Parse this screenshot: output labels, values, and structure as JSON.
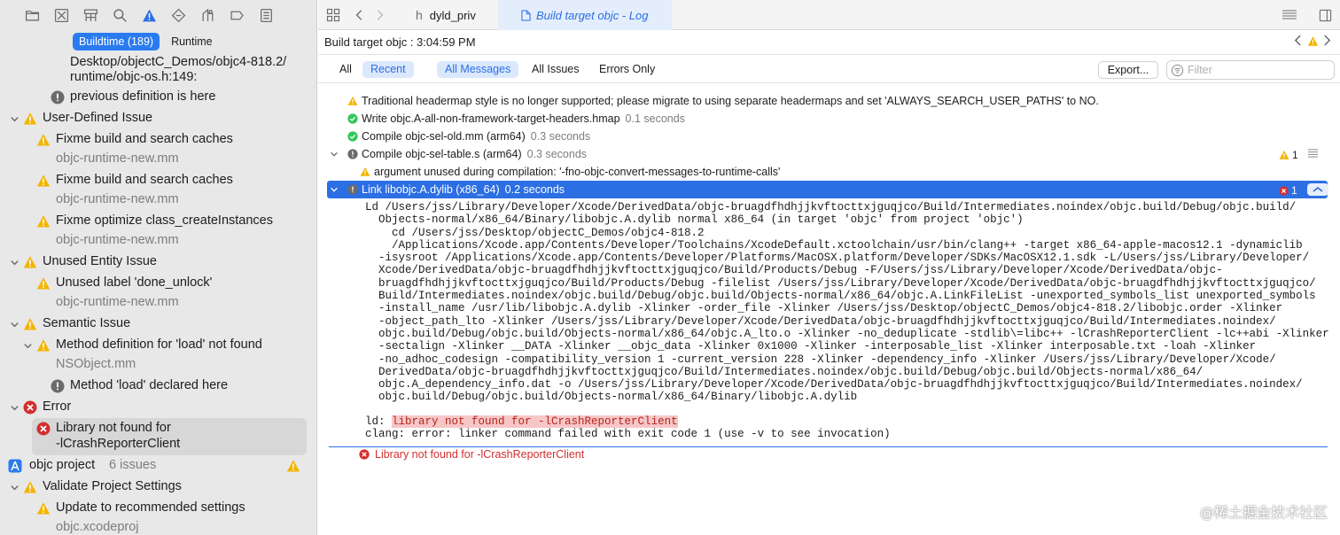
{
  "navigator": {
    "scope_buildtime": "Buildtime (189)",
    "scope_runtime": "Runtime",
    "items": [
      {
        "text": "Desktop/objectC_Demos/objc4-818.2/",
        "kind": "path"
      },
      {
        "text": "runtime/objc-os.h:149:",
        "kind": "path"
      },
      {
        "text": "previous definition is here",
        "kind": "note"
      },
      {
        "text": "User-Defined Issue",
        "kind": "group"
      },
      {
        "text": "Fixme build and search caches",
        "kind": "warning"
      },
      {
        "text": "objc-runtime-new.mm",
        "kind": "file"
      },
      {
        "text": "Fixme build and search caches",
        "kind": "warning"
      },
      {
        "text": "objc-runtime-new.mm",
        "kind": "file"
      },
      {
        "text": "Fixme optimize class_createInstances",
        "kind": "warning"
      },
      {
        "text": "objc-runtime-new.mm",
        "kind": "file"
      },
      {
        "text": "Unused Entity Issue",
        "kind": "group"
      },
      {
        "text": "Unused label 'done_unlock'",
        "kind": "warning"
      },
      {
        "text": "objc-runtime-new.mm",
        "kind": "file"
      },
      {
        "text": "Semantic Issue",
        "kind": "group"
      },
      {
        "text": "Method definition for 'load' not found",
        "kind": "warning"
      },
      {
        "text": "NSObject.mm",
        "kind": "file"
      },
      {
        "text": "Method 'load' declared here",
        "kind": "note"
      },
      {
        "text": "Error",
        "kind": "errorgroup"
      },
      {
        "text": "Library not found for",
        "kind": "error"
      },
      {
        "text": "-lCrashReporterClient",
        "kind": "errorcont"
      },
      {
        "text": "objc project",
        "kind": "project",
        "count": "6 issues"
      },
      {
        "text": "Validate Project Settings",
        "kind": "group"
      },
      {
        "text": "Update to recommended settings",
        "kind": "warning"
      },
      {
        "text": "objc.xcodeproj",
        "kind": "file"
      }
    ]
  },
  "editor": {
    "tab1": "dyld_priv",
    "tab2": "Build target objc - Log",
    "jump_title": "Build target objc : 3:04:59 PM",
    "filters": {
      "all": "All",
      "recent": "Recent",
      "all_messages": "All Messages",
      "all_issues": "All Issues",
      "errors_only": "Errors Only",
      "export": "Export...",
      "filter_placeholder": "Filter"
    },
    "log": [
      {
        "icon": "warning",
        "text": "Traditional headermap style is no longer supported; please migrate to using separate headermaps and set 'ALWAYS_SEARCH_USER_PATHS' to NO.",
        "time": ""
      },
      {
        "icon": "success",
        "text": "Write objc.A-all-non-framework-target-headers.hmap",
        "time": "0.1 seconds"
      },
      {
        "icon": "success",
        "text": "Compile objc-sel-old.mm (arm64)",
        "time": "0.3 seconds"
      },
      {
        "icon": "note",
        "text": "Compile objc-sel-table.s (arm64)",
        "time": "0.3 seconds",
        "badge": "1"
      },
      {
        "icon": "warning",
        "text": "argument unused during compilation: '-fno-objc-convert-messages-to-runtime-calls'",
        "time": ""
      },
      {
        "icon": "note",
        "text": "Link libobjc.A.dylib (x86_64)",
        "time": "0.2 seconds",
        "badge": "1"
      }
    ],
    "command_lines": [
      "Ld /Users/jss/Library/Developer/Xcode/DerivedData/objc-bruagdfhdhjjkvftocttxjguqjco/Build/Intermediates.noindex/objc.build/Debug/objc.build/",
      "  Objects-normal/x86_64/Binary/libobjc.A.dylib normal x86_64 (in target 'objc' from project 'objc')",
      "    cd /Users/jss/Desktop/objectC_Demos/objc4-818.2",
      "    /Applications/Xcode.app/Contents/Developer/Toolchains/XcodeDefault.xctoolchain/usr/bin/clang++ -target x86_64-apple-macos12.1 -dynamiclib",
      "  -isysroot /Applications/Xcode.app/Contents/Developer/Platforms/MacOSX.platform/Developer/SDKs/MacOSX12.1.sdk -L/Users/jss/Library/Developer/",
      "  Xcode/DerivedData/objc-bruagdfhdhjjkvftocttxjguqjco/Build/Products/Debug -F/Users/jss/Library/Developer/Xcode/DerivedData/objc-",
      "  bruagdfhdhjjkvftocttxjguqjco/Build/Products/Debug -filelist /Users/jss/Library/Developer/Xcode/DerivedData/objc-bruagdfhdhjjkvftocttxjguqjco/",
      "  Build/Intermediates.noindex/objc.build/Debug/objc.build/Objects-normal/x86_64/objc.A.LinkFileList -unexported_symbols_list unexported_symbols",
      "  -install_name /usr/lib/libobjc.A.dylib -Xlinker -order_file -Xlinker /Users/jss/Desktop/objectC_Demos/objc4-818.2/libobjc.order -Xlinker",
      "  -object_path_lto -Xlinker /Users/jss/Library/Developer/Xcode/DerivedData/objc-bruagdfhdhjjkvftocttxjguqjco/Build/Intermediates.noindex/",
      "  objc.build/Debug/objc.build/Objects-normal/x86_64/objc.A_lto.o -Xlinker -no_deduplicate -stdlib\\=libc++ -lCrashReporterClient -lc++abi -Xlinker",
      "  -sectalign -Xlinker __DATA -Xlinker __objc_data -Xlinker 0x1000 -Xlinker -interposable_list -Xlinker interposable.txt -loah -Xlinker",
      "  -no_adhoc_codesign -compatibility_version 1 -current_version 228 -Xlinker -dependency_info -Xlinker /Users/jss/Library/Developer/Xcode/",
      "  DerivedData/objc-bruagdfhdhjjkvftocttxjguqjco/Build/Intermediates.noindex/objc.build/Debug/objc.build/Objects-normal/x86_64/",
      "  objc.A_dependency_info.dat -o /Users/jss/Library/Developer/Xcode/DerivedData/objc-bruagdfhdhjjkvftocttxjguqjco/Build/Intermediates.noindex/",
      "  objc.build/Debug/objc.build/Objects-normal/x86_64/Binary/libobjc.A.dylib"
    ],
    "ld_prefix": "ld: ",
    "ld_error": "library not found for -lCrashReporterClient",
    "clang_line": "clang: error: linker command failed with exit code 1 (use -v to see invocation)",
    "error_summary": "Library not found for -lCrashReporterClient"
  },
  "watermark": "@稀土掘金技术社区",
  "colors": {
    "accent": "#2c6fe4",
    "warning": "#f4b400",
    "error": "#d22f2f",
    "success": "#34c759"
  }
}
